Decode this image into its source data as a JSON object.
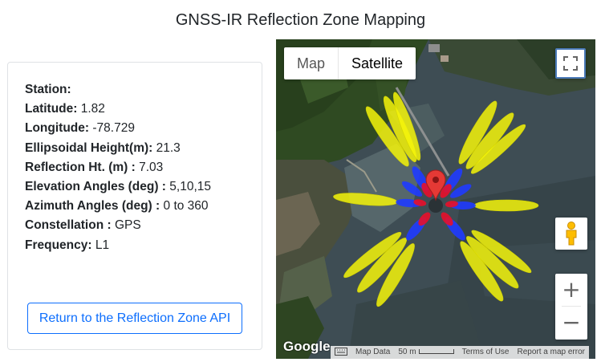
{
  "page": {
    "title": "GNSS-IR Reflection Zone Mapping"
  },
  "station_info": {
    "station_label": "Station:",
    "station_value": "",
    "latitude_label": "Latitude:",
    "latitude_value": "1.82",
    "longitude_label": "Longitude:",
    "longitude_value": "-78.729",
    "ellipsoidal_height_label": "Ellipsoidal Height(m):",
    "ellipsoidal_height_value": "21.3",
    "reflection_ht_label": "Reflection Ht. (m) :",
    "reflection_ht_value": "7.03",
    "elevation_angles_label": "Elevation Angles (deg) :",
    "elevation_angles_value": "5,10,15",
    "azimuth_angles_label": "Azimuth Angles (deg) :",
    "azimuth_angles_value": "0 to 360",
    "constellation_label": "Constellation :",
    "constellation_value": "GPS",
    "frequency_label": "Frequency:",
    "frequency_value": "L1"
  },
  "actions": {
    "return_label": "Return to the Reflection Zone API"
  },
  "map": {
    "type_map_label": "Map",
    "type_satellite_label": "Satellite",
    "active_type": "Satellite",
    "google_label": "Google",
    "attribution": {
      "map_data": "Map Data",
      "scale": "50 m",
      "terms": "Terms of Use",
      "report": "Report a map error"
    },
    "colors": {
      "zone_5deg": "#f5f50a",
      "zone_10deg": "#1f3bff",
      "zone_15deg": "#e8102a",
      "marker": "#e53935"
    },
    "icons": [
      "fullscreen-icon",
      "pegman-icon",
      "zoom-in-icon",
      "zoom-out-icon",
      "keyboard-icon",
      "map-marker-icon"
    ]
  }
}
